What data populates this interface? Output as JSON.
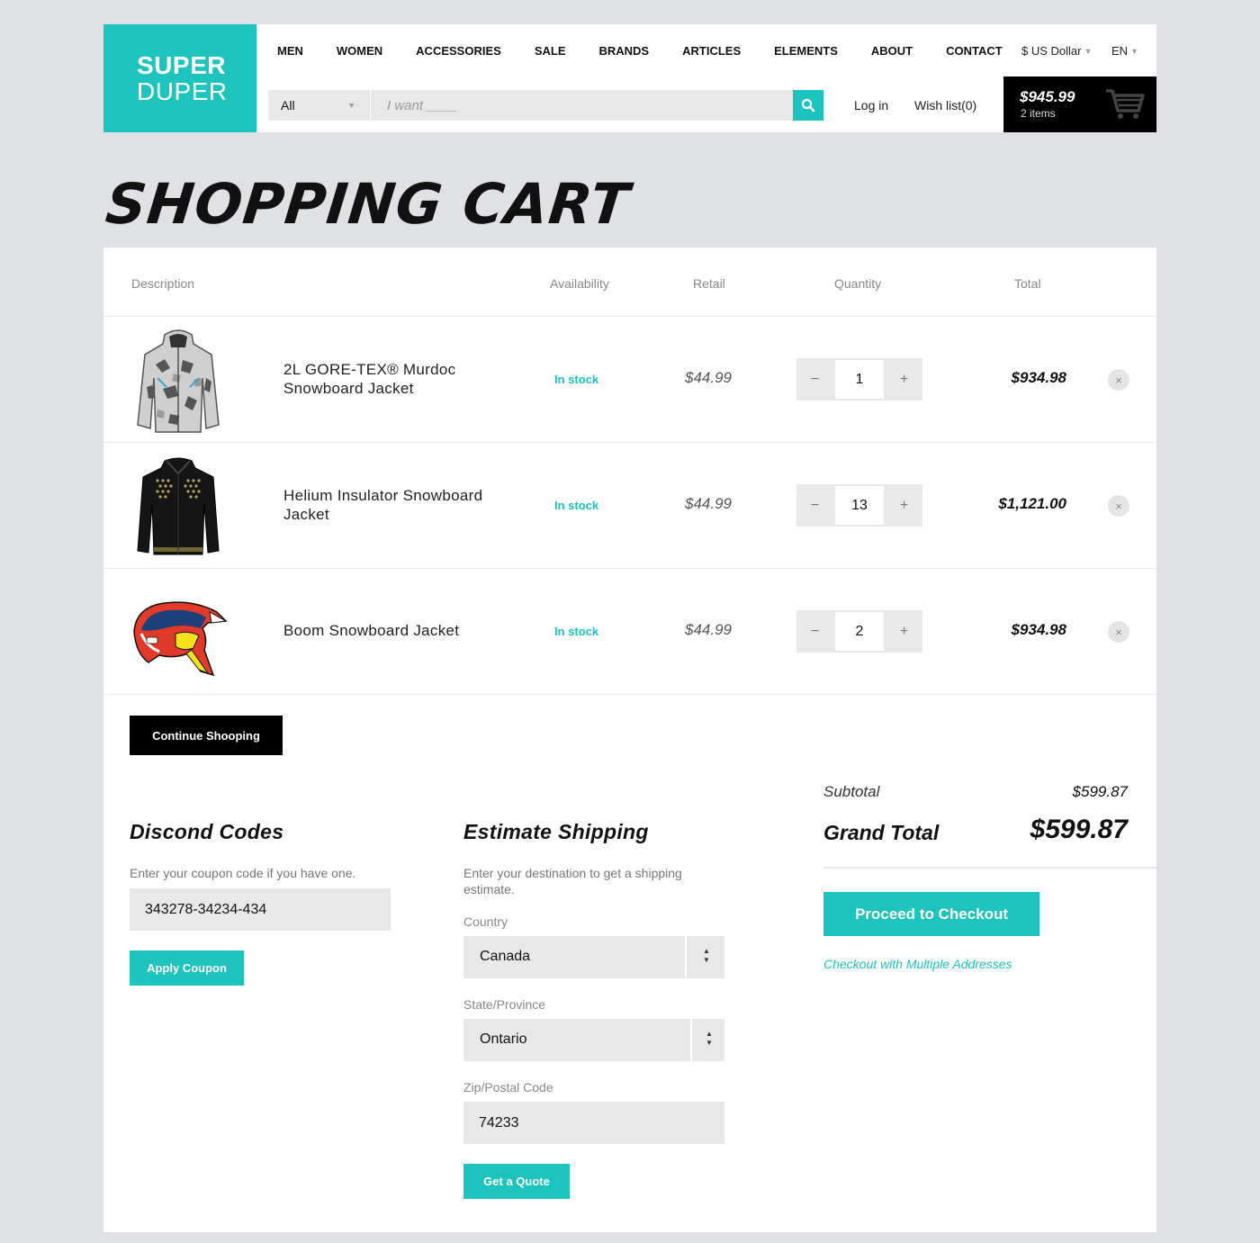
{
  "logo": {
    "line1": "SUPER",
    "line2": "DUPER"
  },
  "nav": [
    "MEN",
    "WOMEN",
    "ACCESSORIES",
    "SALE",
    "BRANDS",
    "ARTICLES",
    "ELEMENTS",
    "ABOUT",
    "CONTACT"
  ],
  "currency": "$ US Dollar",
  "language": "EN",
  "search": {
    "category": "All",
    "placeholder": "I want ____"
  },
  "account": {
    "login": "Log in",
    "wishlist": "Wish list(0)"
  },
  "cart": {
    "amount": "$945.99",
    "items": "2 items"
  },
  "page_title": "SHOPPING CART",
  "table": {
    "headers": [
      "Description",
      "Availability",
      "Retail",
      "Quantity",
      "Total"
    ],
    "rows": [
      {
        "name": "2L GORE-TEX® Murdoc Snowboard Jacket",
        "availability": "In stock",
        "retail": "$44.99",
        "qty": "1",
        "total": "$934.98",
        "image": "camo-jacket"
      },
      {
        "name": "Helium Insulator Snowboard Jacket",
        "availability": "In stock",
        "retail": "$44.99",
        "qty": "13",
        "total": "$1,121.00",
        "image": "black-jacket"
      },
      {
        "name": "Boom Snowboard Jacket",
        "availability": "In stock",
        "retail": "$44.99",
        "qty": "2",
        "total": "$934.98",
        "image": "helmet"
      }
    ],
    "minus": "−",
    "plus": "+",
    "remove": "×"
  },
  "continue_label": "Continue Shooping",
  "discount": {
    "title": "Discond Codes",
    "hint": "Enter your coupon code if you have one.",
    "code": "343278-34234-434",
    "button": "Apply Coupon"
  },
  "shipping": {
    "title": "Estimate Shipping",
    "hint": "Enter your destination to get a shipping estimate.",
    "country_label": "Country",
    "country": "Canada",
    "state_label": "State/Province",
    "state": "Ontario",
    "zip_label": "Zip/Postal Code",
    "zip": "74233",
    "button": "Get a Quote"
  },
  "summary": {
    "subtotal_label": "Subtotal",
    "subtotal": "$599.87",
    "grand_label": "Grand Total",
    "grand": "$599.87",
    "checkout": "Proceed to Checkout",
    "multi": "Checkout with Multiple Addresses"
  },
  "colors": {
    "accent": "#1cc4bd",
    "dark": "#000000",
    "background": "#dfe1e4"
  }
}
